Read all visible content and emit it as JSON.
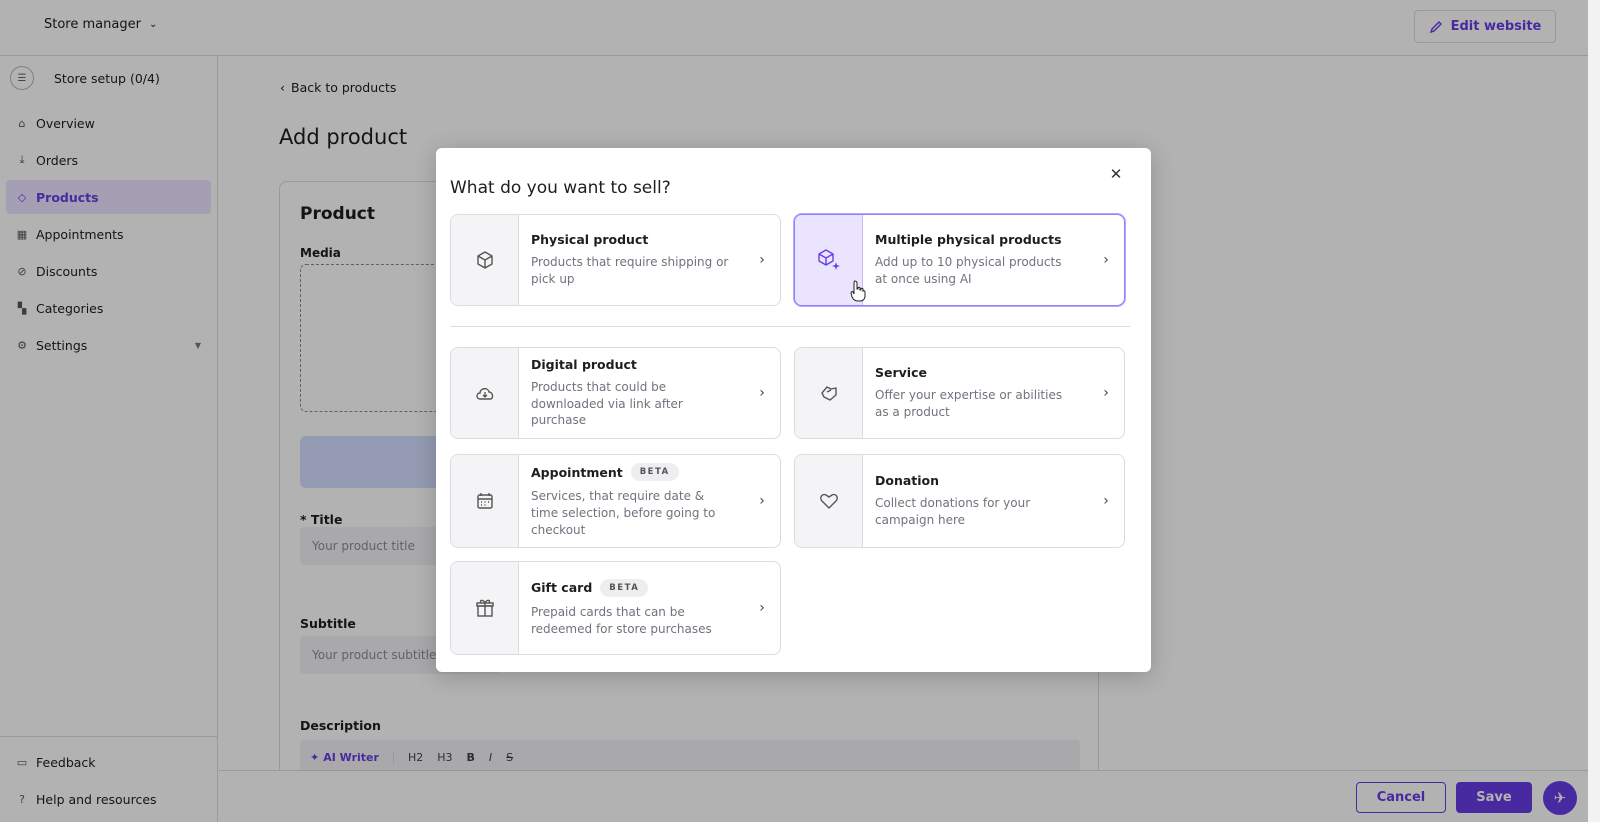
{
  "topbar": {
    "store_manager": "Store manager",
    "edit_website": "Edit website"
  },
  "sidebar": {
    "setup": "Store setup (0/4)",
    "items": [
      {
        "label": "Overview",
        "icon": "home-icon"
      },
      {
        "label": "Orders",
        "icon": "download-icon"
      },
      {
        "label": "Products",
        "icon": "tag-icon",
        "active": true
      },
      {
        "label": "Appointments",
        "icon": "calendar-icon"
      },
      {
        "label": "Discounts",
        "icon": "discount-icon"
      },
      {
        "label": "Categories",
        "icon": "grid-icon"
      },
      {
        "label": "Settings",
        "icon": "gear-icon"
      }
    ],
    "feedback": "Feedback",
    "help": "Help and resources"
  },
  "main": {
    "back": "Back to products",
    "title": "Add product",
    "card_title": "Product",
    "media_label": "Media",
    "title_label": "* Title",
    "title_placeholder": "Your product title",
    "subtitle_label": "Subtitle",
    "subtitle_placeholder": "Your product subtitle",
    "description_label": "Description",
    "ai_writer": "AI Writer",
    "toolbar": [
      "H2",
      "H3",
      "B",
      "I",
      "S"
    ]
  },
  "footer": {
    "cancel": "Cancel",
    "save": "Save"
  },
  "modal": {
    "title": "What do you want to sell?",
    "options": [
      {
        "name": "Physical product",
        "desc": "Products that require shipping or pick up",
        "icon": "box-icon"
      },
      {
        "name": "Multiple physical products",
        "desc": "Add up to 10 physical products at once using AI",
        "icon": "box-sparkle-icon"
      },
      {
        "name": "Digital product",
        "desc": "Products that could be downloaded via link after purchase",
        "icon": "cloud-download-icon"
      },
      {
        "name": "Service",
        "desc": "Offer your expertise or abilities as a product",
        "icon": "handshake-icon"
      },
      {
        "name": "Appointment",
        "badge": "BETA",
        "desc": "Services, that require date & time selection, before going to checkout",
        "icon": "calendar-icon"
      },
      {
        "name": "Donation",
        "desc": "Collect donations for your campaign here",
        "icon": "heart-icon"
      },
      {
        "name": "Gift card",
        "badge": "BETA",
        "desc": "Prepaid cards that can be redeemed for store purchases",
        "icon": "gift-icon"
      }
    ]
  },
  "colors": {
    "accent": "#673de6",
    "highlight_bg": "#ebe4ff"
  }
}
